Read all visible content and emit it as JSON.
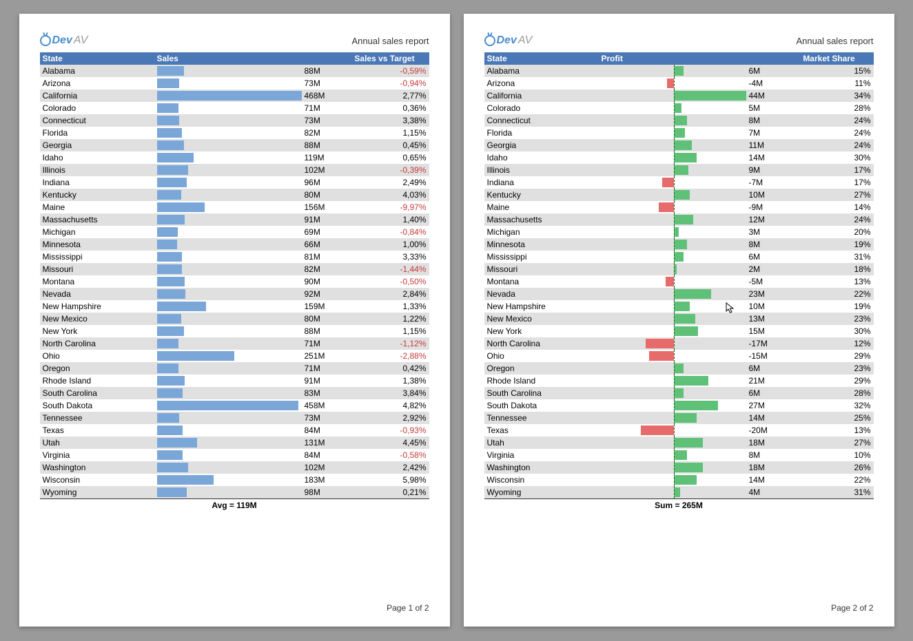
{
  "brand": {
    "name_blue": "Dev",
    "name_gray": "AV"
  },
  "report_title": "Annual sales report",
  "page1": {
    "headers": {
      "state": "State",
      "sales": "Sales",
      "svt": "Sales vs Target"
    },
    "summary": "Avg = 119M",
    "footer": "Page 1 of 2",
    "max_sales": 468,
    "rows": [
      {
        "state": "Alabama",
        "sales": 88,
        "sales_label": "88M",
        "svt": -0.59,
        "svt_label": "-0,59%"
      },
      {
        "state": "Arizona",
        "sales": 73,
        "sales_label": "73M",
        "svt": -0.94,
        "svt_label": "-0,94%"
      },
      {
        "state": "California",
        "sales": 468,
        "sales_label": "468M",
        "svt": 2.77,
        "svt_label": "2,77%"
      },
      {
        "state": "Colorado",
        "sales": 71,
        "sales_label": "71M",
        "svt": 0.36,
        "svt_label": "0,36%"
      },
      {
        "state": "Connecticut",
        "sales": 73,
        "sales_label": "73M",
        "svt": 3.38,
        "svt_label": "3,38%"
      },
      {
        "state": "Florida",
        "sales": 82,
        "sales_label": "82M",
        "svt": 1.15,
        "svt_label": "1,15%"
      },
      {
        "state": "Georgia",
        "sales": 88,
        "sales_label": "88M",
        "svt": 0.45,
        "svt_label": "0,45%"
      },
      {
        "state": "Idaho",
        "sales": 119,
        "sales_label": "119M",
        "svt": 0.65,
        "svt_label": "0,65%"
      },
      {
        "state": "Illinois",
        "sales": 102,
        "sales_label": "102M",
        "svt": -0.39,
        "svt_label": "-0,39%"
      },
      {
        "state": "Indiana",
        "sales": 96,
        "sales_label": "96M",
        "svt": 2.49,
        "svt_label": "2,49%"
      },
      {
        "state": "Kentucky",
        "sales": 80,
        "sales_label": "80M",
        "svt": 4.03,
        "svt_label": "4,03%"
      },
      {
        "state": "Maine",
        "sales": 156,
        "sales_label": "156M",
        "svt": -9.97,
        "svt_label": "-9,97%"
      },
      {
        "state": "Massachusetts",
        "sales": 91,
        "sales_label": "91M",
        "svt": 1.4,
        "svt_label": "1,40%"
      },
      {
        "state": "Michigan",
        "sales": 69,
        "sales_label": "69M",
        "svt": -0.84,
        "svt_label": "-0,84%"
      },
      {
        "state": "Minnesota",
        "sales": 66,
        "sales_label": "66M",
        "svt": 1.0,
        "svt_label": "1,00%"
      },
      {
        "state": "Mississippi",
        "sales": 81,
        "sales_label": "81M",
        "svt": 3.33,
        "svt_label": "3,33%"
      },
      {
        "state": "Missouri",
        "sales": 82,
        "sales_label": "82M",
        "svt": -1.44,
        "svt_label": "-1,44%"
      },
      {
        "state": "Montana",
        "sales": 90,
        "sales_label": "90M",
        "svt": -0.5,
        "svt_label": "-0,50%"
      },
      {
        "state": "Nevada",
        "sales": 92,
        "sales_label": "92M",
        "svt": 2.84,
        "svt_label": "2,84%"
      },
      {
        "state": "New Hampshire",
        "sales": 159,
        "sales_label": "159M",
        "svt": 1.33,
        "svt_label": "1,33%"
      },
      {
        "state": "New Mexico",
        "sales": 80,
        "sales_label": "80M",
        "svt": 1.22,
        "svt_label": "1,22%"
      },
      {
        "state": "New York",
        "sales": 88,
        "sales_label": "88M",
        "svt": 1.15,
        "svt_label": "1,15%"
      },
      {
        "state": "North Carolina",
        "sales": 71,
        "sales_label": "71M",
        "svt": -1.12,
        "svt_label": "-1,12%"
      },
      {
        "state": "Ohio",
        "sales": 251,
        "sales_label": "251M",
        "svt": -2.88,
        "svt_label": "-2,88%"
      },
      {
        "state": "Oregon",
        "sales": 71,
        "sales_label": "71M",
        "svt": 0.42,
        "svt_label": "0,42%"
      },
      {
        "state": "Rhode Island",
        "sales": 91,
        "sales_label": "91M",
        "svt": 1.38,
        "svt_label": "1,38%"
      },
      {
        "state": "South Carolina",
        "sales": 83,
        "sales_label": "83M",
        "svt": 3.84,
        "svt_label": "3,84%"
      },
      {
        "state": "South Dakota",
        "sales": 458,
        "sales_label": "458M",
        "svt": 4.82,
        "svt_label": "4,82%"
      },
      {
        "state": "Tennessee",
        "sales": 73,
        "sales_label": "73M",
        "svt": 2.92,
        "svt_label": "2,92%"
      },
      {
        "state": "Texas",
        "sales": 84,
        "sales_label": "84M",
        "svt": -0.93,
        "svt_label": "-0,93%"
      },
      {
        "state": "Utah",
        "sales": 131,
        "sales_label": "131M",
        "svt": 4.45,
        "svt_label": "4,45%"
      },
      {
        "state": "Virginia",
        "sales": 84,
        "sales_label": "84M",
        "svt": -0.58,
        "svt_label": "-0,58%"
      },
      {
        "state": "Washington",
        "sales": 102,
        "sales_label": "102M",
        "svt": 2.42,
        "svt_label": "2,42%"
      },
      {
        "state": "Wisconsin",
        "sales": 183,
        "sales_label": "183M",
        "svt": 5.98,
        "svt_label": "5,98%"
      },
      {
        "state": "Wyoming",
        "sales": 98,
        "sales_label": "98M",
        "svt": 0.21,
        "svt_label": "0,21%"
      }
    ]
  },
  "page2": {
    "headers": {
      "state": "State",
      "profit": "Profit",
      "ms": "Market Share"
    },
    "summary": "Sum = 265M",
    "footer": "Page 2 of 2",
    "max_abs_profit": 44,
    "rows": [
      {
        "state": "Alabama",
        "profit": 6,
        "profit_label": "6M",
        "ms": "15%"
      },
      {
        "state": "Arizona",
        "profit": -4,
        "profit_label": "-4M",
        "ms": "11%"
      },
      {
        "state": "California",
        "profit": 44,
        "profit_label": "44M",
        "ms": "34%"
      },
      {
        "state": "Colorado",
        "profit": 5,
        "profit_label": "5M",
        "ms": "28%"
      },
      {
        "state": "Connecticut",
        "profit": 8,
        "profit_label": "8M",
        "ms": "24%"
      },
      {
        "state": "Florida",
        "profit": 7,
        "profit_label": "7M",
        "ms": "24%"
      },
      {
        "state": "Georgia",
        "profit": 11,
        "profit_label": "11M",
        "ms": "24%"
      },
      {
        "state": "Idaho",
        "profit": 14,
        "profit_label": "14M",
        "ms": "30%"
      },
      {
        "state": "Illinois",
        "profit": 9,
        "profit_label": "9M",
        "ms": "17%"
      },
      {
        "state": "Indiana",
        "profit": -7,
        "profit_label": "-7M",
        "ms": "17%"
      },
      {
        "state": "Kentucky",
        "profit": 10,
        "profit_label": "10M",
        "ms": "27%"
      },
      {
        "state": "Maine",
        "profit": -9,
        "profit_label": "-9M",
        "ms": "14%"
      },
      {
        "state": "Massachusetts",
        "profit": 12,
        "profit_label": "12M",
        "ms": "24%"
      },
      {
        "state": "Michigan",
        "profit": 3,
        "profit_label": "3M",
        "ms": "20%"
      },
      {
        "state": "Minnesota",
        "profit": 8,
        "profit_label": "8M",
        "ms": "19%"
      },
      {
        "state": "Mississippi",
        "profit": 6,
        "profit_label": "6M",
        "ms": "31%"
      },
      {
        "state": "Missouri",
        "profit": 2,
        "profit_label": "2M",
        "ms": "18%"
      },
      {
        "state": "Montana",
        "profit": -5,
        "profit_label": "-5M",
        "ms": "13%"
      },
      {
        "state": "Nevada",
        "profit": 23,
        "profit_label": "23M",
        "ms": "22%"
      },
      {
        "state": "New Hampshire",
        "profit": 10,
        "profit_label": "10M",
        "ms": "19%"
      },
      {
        "state": "New Mexico",
        "profit": 13,
        "profit_label": "13M",
        "ms": "23%"
      },
      {
        "state": "New York",
        "profit": 15,
        "profit_label": "15M",
        "ms": "30%"
      },
      {
        "state": "North Carolina",
        "profit": -17,
        "profit_label": "-17M",
        "ms": "12%"
      },
      {
        "state": "Ohio",
        "profit": -15,
        "profit_label": "-15M",
        "ms": "29%"
      },
      {
        "state": "Oregon",
        "profit": 6,
        "profit_label": "6M",
        "ms": "23%"
      },
      {
        "state": "Rhode Island",
        "profit": 21,
        "profit_label": "21M",
        "ms": "29%"
      },
      {
        "state": "South Carolina",
        "profit": 6,
        "profit_label": "6M",
        "ms": "28%"
      },
      {
        "state": "South Dakota",
        "profit": 27,
        "profit_label": "27M",
        "ms": "32%"
      },
      {
        "state": "Tennessee",
        "profit": 14,
        "profit_label": "14M",
        "ms": "25%"
      },
      {
        "state": "Texas",
        "profit": -20,
        "profit_label": "-20M",
        "ms": "13%"
      },
      {
        "state": "Utah",
        "profit": 18,
        "profit_label": "18M",
        "ms": "27%"
      },
      {
        "state": "Virginia",
        "profit": 8,
        "profit_label": "8M",
        "ms": "10%"
      },
      {
        "state": "Washington",
        "profit": 18,
        "profit_label": "18M",
        "ms": "26%"
      },
      {
        "state": "Wisconsin",
        "profit": 14,
        "profit_label": "14M",
        "ms": "22%"
      },
      {
        "state": "Wyoming",
        "profit": 4,
        "profit_label": "4M",
        "ms": "31%"
      }
    ]
  },
  "chart_data": [
    {
      "type": "bar",
      "title": "Sales",
      "categories": [
        "Alabama",
        "Arizona",
        "California",
        "Colorado",
        "Connecticut",
        "Florida",
        "Georgia",
        "Idaho",
        "Illinois",
        "Indiana",
        "Kentucky",
        "Maine",
        "Massachusetts",
        "Michigan",
        "Minnesota",
        "Mississippi",
        "Missouri",
        "Montana",
        "Nevada",
        "New Hampshire",
        "New Mexico",
        "New York",
        "North Carolina",
        "Ohio",
        "Oregon",
        "Rhode Island",
        "South Carolina",
        "South Dakota",
        "Tennessee",
        "Texas",
        "Utah",
        "Virginia",
        "Washington",
        "Wisconsin",
        "Wyoming"
      ],
      "values": [
        88,
        73,
        468,
        71,
        73,
        82,
        88,
        119,
        102,
        96,
        80,
        156,
        91,
        69,
        66,
        81,
        82,
        90,
        92,
        159,
        80,
        88,
        71,
        251,
        71,
        91,
        83,
        458,
        73,
        84,
        131,
        84,
        102,
        183,
        98
      ],
      "xlabel": "State",
      "ylabel": "Sales (M)"
    },
    {
      "type": "bar",
      "title": "Profit",
      "categories": [
        "Alabama",
        "Arizona",
        "California",
        "Colorado",
        "Connecticut",
        "Florida",
        "Georgia",
        "Idaho",
        "Illinois",
        "Indiana",
        "Kentucky",
        "Maine",
        "Massachusetts",
        "Michigan",
        "Minnesota",
        "Mississippi",
        "Missouri",
        "Montana",
        "Nevada",
        "New Hampshire",
        "New Mexico",
        "New York",
        "North Carolina",
        "Ohio",
        "Oregon",
        "Rhode Island",
        "South Carolina",
        "South Dakota",
        "Tennessee",
        "Texas",
        "Utah",
        "Virginia",
        "Washington",
        "Wisconsin",
        "Wyoming"
      ],
      "values": [
        6,
        -4,
        44,
        5,
        8,
        7,
        11,
        14,
        9,
        -7,
        10,
        -9,
        12,
        3,
        8,
        6,
        2,
        -5,
        23,
        10,
        13,
        15,
        -17,
        -15,
        6,
        21,
        6,
        27,
        14,
        -20,
        18,
        8,
        18,
        14,
        4
      ],
      "xlabel": "State",
      "ylabel": "Profit (M)"
    }
  ]
}
